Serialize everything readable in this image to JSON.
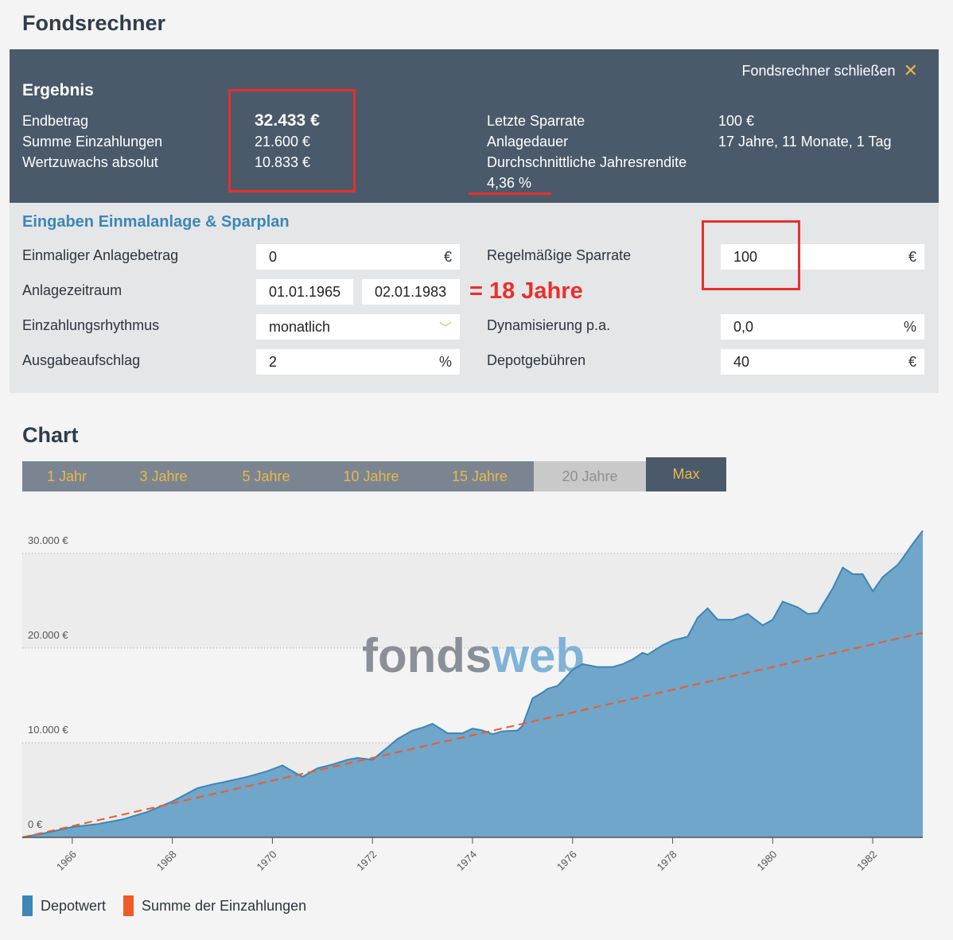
{
  "page": {
    "title": "Fondsrechner"
  },
  "result": {
    "close_label": "Fondsrechner schließen",
    "close_glyph": "✕",
    "title": "Ergebnis",
    "left": [
      {
        "label": "Endbetrag",
        "value": "32.433 €"
      },
      {
        "label": "Summe Einzahlungen",
        "value": "21.600 €"
      },
      {
        "label": "Wertzuwachs absolut",
        "value": "10.833 €"
      }
    ],
    "right": [
      {
        "label": "Letzte Sparrate",
        "value": "100 €"
      },
      {
        "label": "Anlagedauer",
        "value": "17 Jahre, 11 Monate, 1 Tag"
      },
      {
        "label": "Durchschnittliche Jahresrendite",
        "value": "4,36 %"
      }
    ]
  },
  "inputs": {
    "title": "Eingaben Einmalanlage & Sparplan",
    "einmalig": {
      "label": "Einmaliger Anlagebetrag",
      "value": "0",
      "unit": "€"
    },
    "zeitraum": {
      "label": "Anlagezeitraum",
      "start": "01.01.1965",
      "end": "02.01.1983"
    },
    "rhythmus": {
      "label": "Einzahlungsrhythmus",
      "value": "monatlich",
      "chevron": "﹀"
    },
    "aufschlag": {
      "label": "Ausgabeaufschlag",
      "value": "2",
      "unit": "%"
    },
    "sparrate": {
      "label": "Regelmäßige Sparrate",
      "value": "100",
      "unit": "€"
    },
    "dynamik": {
      "label": "Dynamisierung p.a.",
      "value": "0,0",
      "unit": "%"
    },
    "gebuehren": {
      "label": "Depotgebühren",
      "value": "40",
      "unit": "€"
    },
    "annotation": "= 18 Jahre"
  },
  "chart_section": {
    "title": "Chart",
    "tabs": [
      {
        "label": "1 Jahr",
        "state": "normal"
      },
      {
        "label": "3 Jahre",
        "state": "normal"
      },
      {
        "label": "5 Jahre",
        "state": "normal"
      },
      {
        "label": "10 Jahre",
        "state": "normal"
      },
      {
        "label": "15 Jahre",
        "state": "normal"
      },
      {
        "label": "20 Jahre",
        "state": "disabled"
      },
      {
        "label": "Max",
        "state": "active"
      }
    ],
    "watermark": {
      "part1": "fonds",
      "part2": "web"
    },
    "legend": [
      {
        "label": "Depotwert",
        "color": "#3c86b8"
      },
      {
        "label": "Summe der Einzahlungen",
        "color": "#f05a28"
      }
    ]
  },
  "chart_data": {
    "type": "area",
    "x_unit": "year",
    "xlim": [
      1965.0,
      1983.0
    ],
    "ylim": [
      0,
      32000
    ],
    "yticks": [
      0,
      10000,
      20000,
      30000
    ],
    "ytick_labels": [
      "0 €",
      "10.000 €",
      "20.000 €",
      "30.000 €"
    ],
    "xticks": [
      1966,
      1968,
      1970,
      1972,
      1974,
      1976,
      1978,
      1980,
      1982
    ],
    "xtick_labels": [
      "1966",
      "1968",
      "1970",
      "1972",
      "1974",
      "1976",
      "1978",
      "1980",
      "1982"
    ],
    "grid": true,
    "legend_position": "bottom-left",
    "series": [
      {
        "name": "Depotwert",
        "type": "area",
        "color": "#6fa6ca",
        "points": [
          [
            1965.0,
            0
          ],
          [
            1965.5,
            500
          ],
          [
            1966.0,
            1100
          ],
          [
            1966.5,
            1400
          ],
          [
            1967.0,
            1900
          ],
          [
            1967.5,
            2700
          ],
          [
            1968.0,
            3800
          ],
          [
            1968.5,
            5200
          ],
          [
            1968.8,
            5600
          ],
          [
            1969.0,
            5800
          ],
          [
            1969.5,
            6400
          ],
          [
            1969.9,
            7000
          ],
          [
            1970.0,
            7200
          ],
          [
            1970.2,
            7600
          ],
          [
            1970.4,
            7000
          ],
          [
            1970.6,
            6400
          ],
          [
            1970.9,
            7300
          ],
          [
            1971.2,
            7700
          ],
          [
            1971.5,
            8200
          ],
          [
            1971.7,
            8400
          ],
          [
            1972.0,
            8200
          ],
          [
            1972.3,
            9500
          ],
          [
            1972.5,
            10400
          ],
          [
            1972.8,
            11300
          ],
          [
            1973.0,
            11600
          ],
          [
            1973.2,
            12000
          ],
          [
            1973.5,
            11000
          ],
          [
            1973.8,
            11000
          ],
          [
            1974.0,
            11500
          ],
          [
            1974.2,
            11300
          ],
          [
            1974.4,
            10900
          ],
          [
            1974.6,
            11200
          ],
          [
            1974.9,
            11300
          ],
          [
            1975.0,
            11800
          ],
          [
            1975.2,
            14700
          ],
          [
            1975.4,
            15300
          ],
          [
            1975.5,
            15700
          ],
          [
            1975.7,
            16000
          ],
          [
            1976.0,
            17700
          ],
          [
            1976.2,
            18300
          ],
          [
            1976.5,
            18000
          ],
          [
            1976.8,
            18000
          ],
          [
            1977.0,
            18300
          ],
          [
            1977.2,
            18800
          ],
          [
            1977.4,
            19500
          ],
          [
            1977.5,
            19300
          ],
          [
            1977.8,
            20300
          ],
          [
            1978.0,
            20800
          ],
          [
            1978.3,
            21200
          ],
          [
            1978.5,
            23200
          ],
          [
            1978.7,
            24200
          ],
          [
            1978.9,
            23000
          ],
          [
            1979.2,
            23000
          ],
          [
            1979.5,
            23600
          ],
          [
            1979.8,
            22400
          ],
          [
            1980.0,
            23000
          ],
          [
            1980.2,
            24900
          ],
          [
            1980.5,
            24300
          ],
          [
            1980.7,
            23600
          ],
          [
            1980.9,
            23700
          ],
          [
            1981.2,
            26300
          ],
          [
            1981.4,
            28500
          ],
          [
            1981.6,
            27800
          ],
          [
            1981.8,
            27800
          ],
          [
            1982.0,
            26000
          ],
          [
            1982.2,
            27500
          ],
          [
            1982.5,
            28800
          ],
          [
            1982.6,
            29500
          ],
          [
            1982.8,
            31000
          ],
          [
            1983.0,
            32400
          ]
        ]
      },
      {
        "name": "Summe der Einzahlungen",
        "type": "line",
        "dashed": true,
        "color": "#f05a28",
        "points": [
          [
            1965.0,
            0
          ],
          [
            1983.0,
            21600
          ]
        ]
      }
    ]
  }
}
